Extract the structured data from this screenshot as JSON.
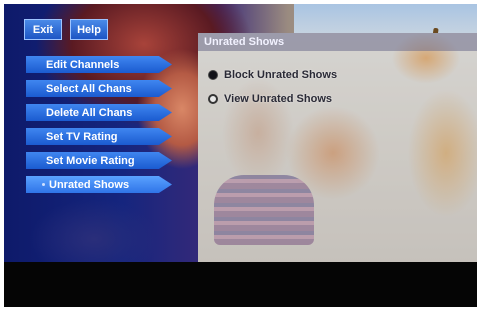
{
  "top_buttons": {
    "exit_label": "Exit",
    "help_label": "Help"
  },
  "menu": {
    "items": [
      {
        "label": "Edit Channels"
      },
      {
        "label": "Select All Chans"
      },
      {
        "label": "Delete All Chans"
      },
      {
        "label": "Set TV Rating"
      },
      {
        "label": "Set Movie Rating"
      },
      {
        "label": "Unrated Shows",
        "selected": true
      }
    ]
  },
  "panel": {
    "title": "Unrated Shows",
    "options": [
      {
        "label": "Block Unrated Shows",
        "selected": true
      },
      {
        "label": "View Unrated Shows",
        "selected": false
      }
    ]
  },
  "colors": {
    "button_blue": "#1d55c4",
    "selected_blue": "#5aa2ff",
    "panel_title_bg": "#6e6e8c"
  }
}
